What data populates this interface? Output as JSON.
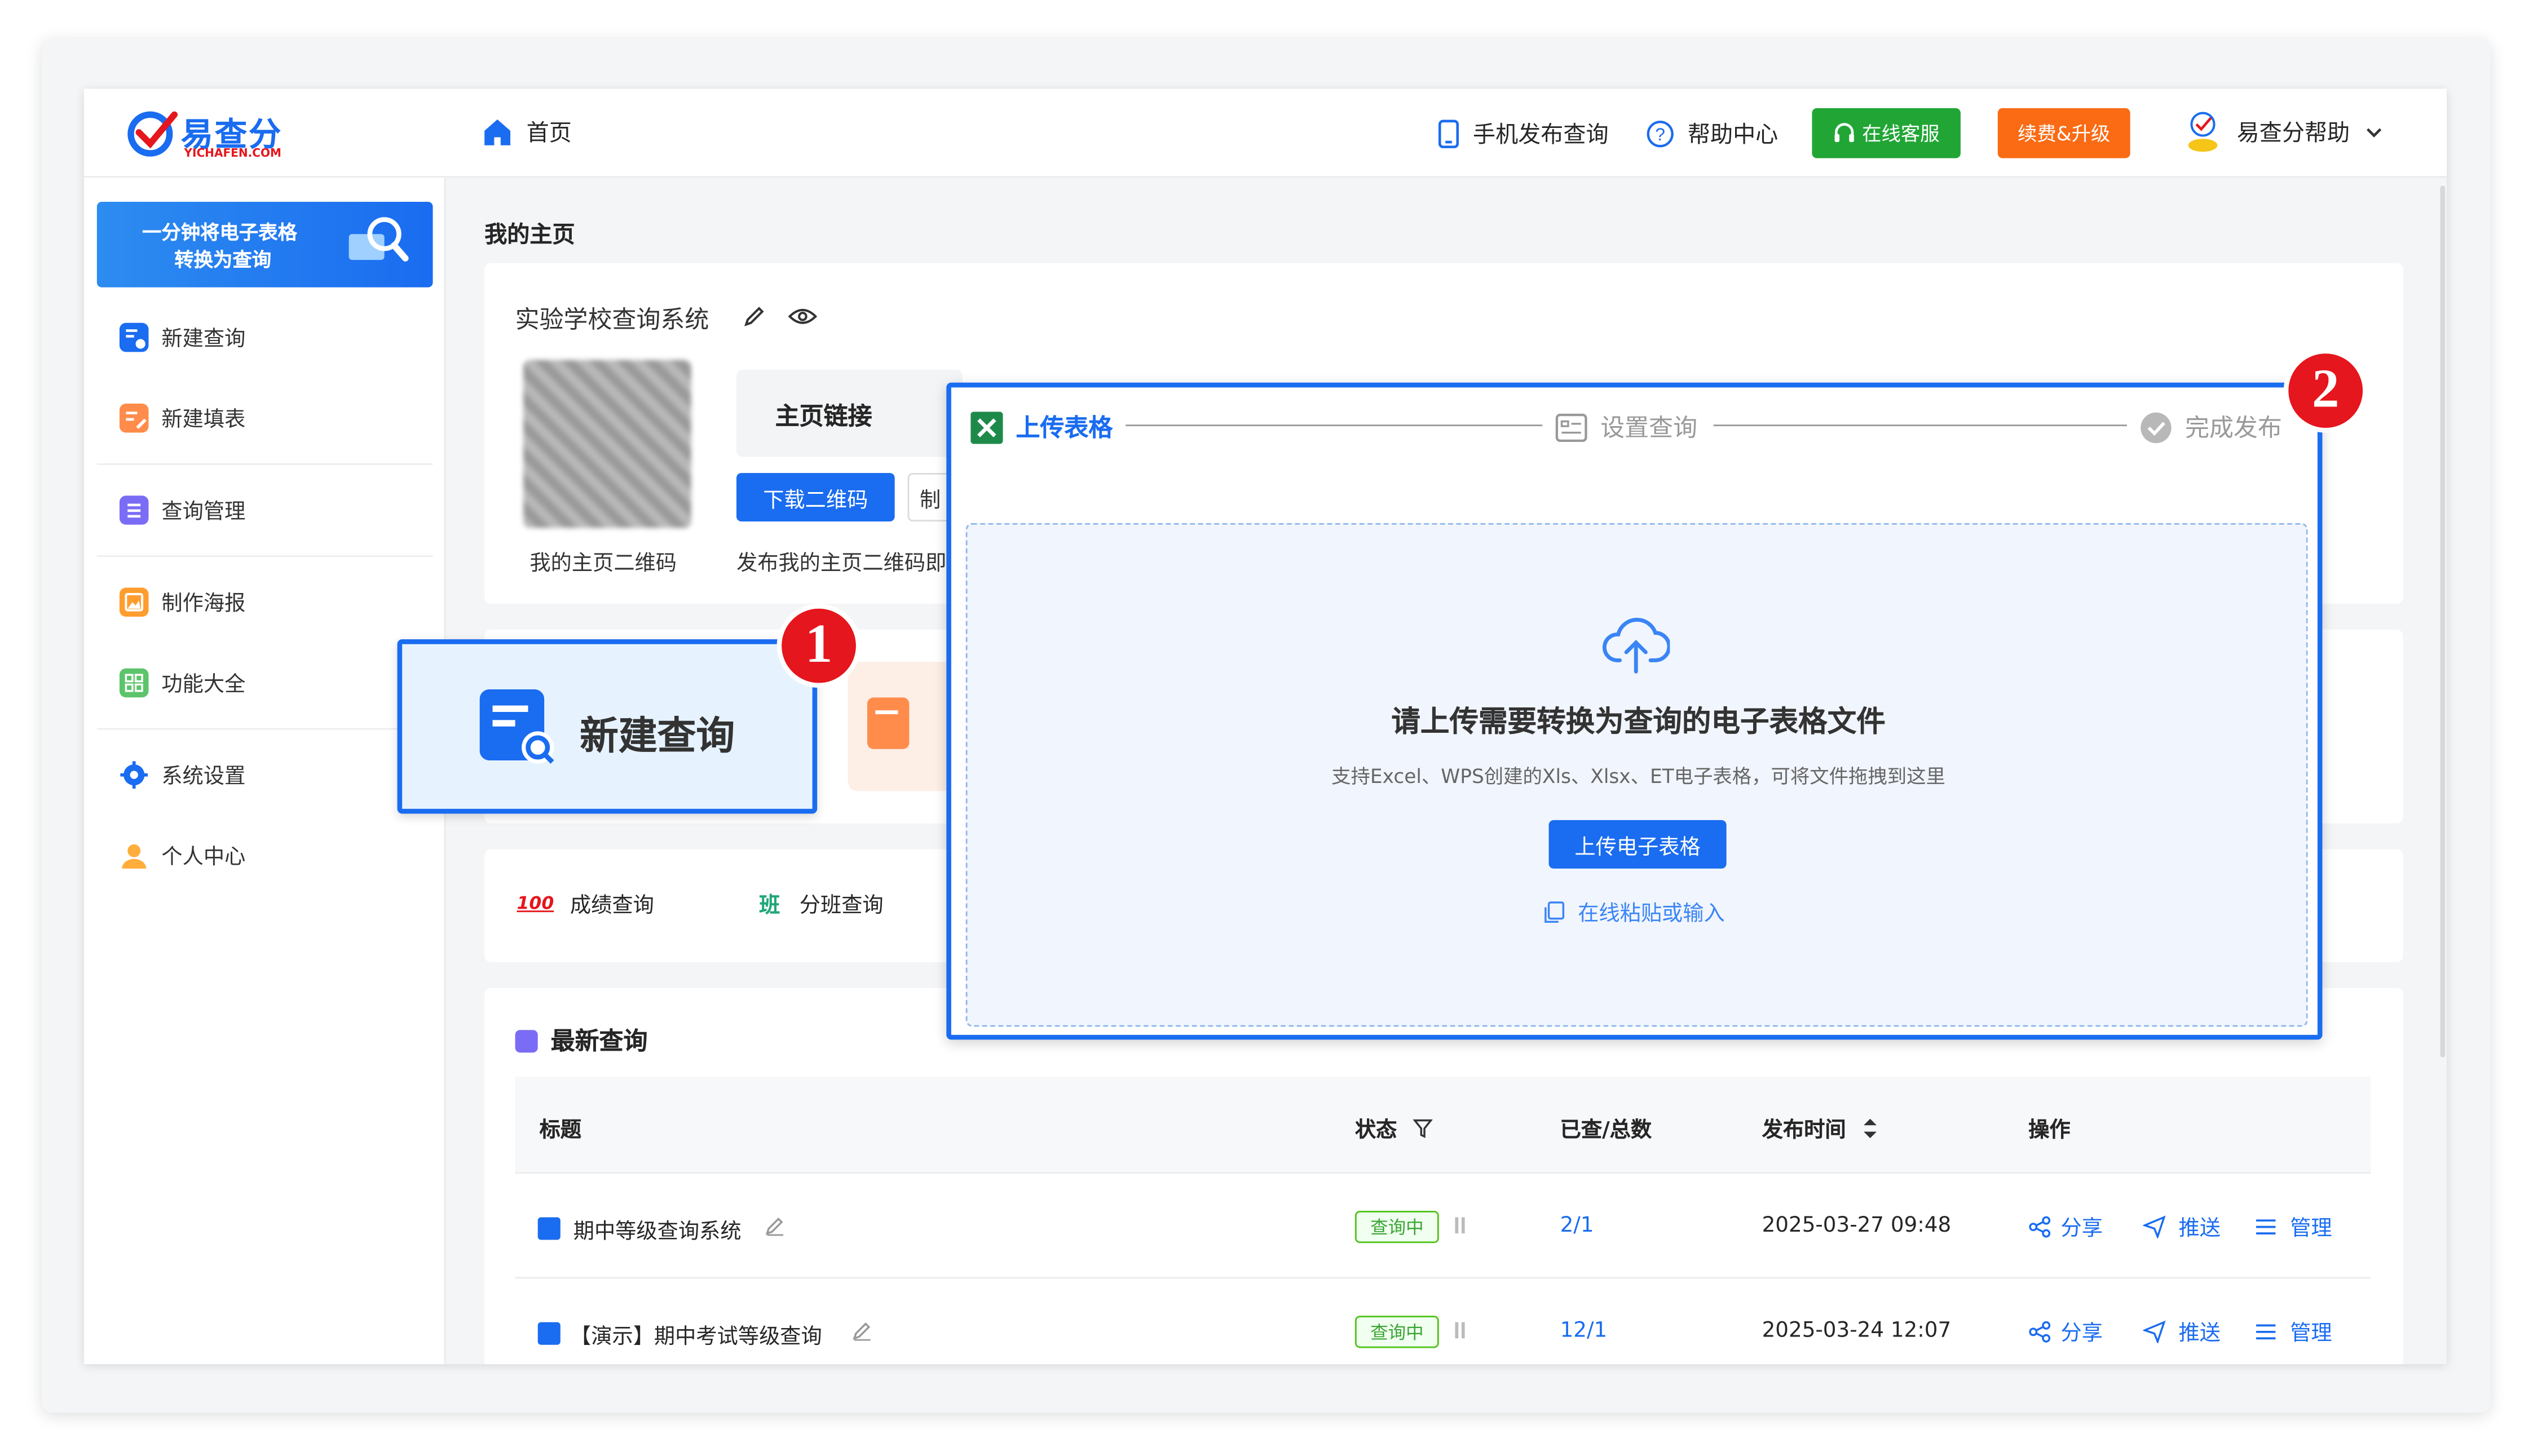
{
  "logo": {
    "name": "易查分",
    "sub": "YICHAFEN.COM"
  },
  "header": {
    "home": "首页",
    "mobile_publish": "手机发布查询",
    "help_center": "帮助中心",
    "online_service": "在线客服",
    "renew_upgrade": "续费&升级",
    "user_name": "易查分帮助",
    "colors": {
      "green": "#21a635",
      "orange": "#fa6b14",
      "blue": "#1a6cf0"
    }
  },
  "sidebar": {
    "banner": [
      "一分钟将电子表格",
      "转换为查询"
    ],
    "items": [
      {
        "label": "新建查询",
        "icon": "new-query-icon"
      },
      {
        "label": "新建填表",
        "icon": "new-form-icon"
      },
      {
        "label": "查询管理",
        "icon": "query-manage-icon"
      },
      {
        "label": "制作海报",
        "icon": "poster-icon"
      },
      {
        "label": "功能大全",
        "icon": "grid-icon"
      },
      {
        "label": "系统设置",
        "icon": "gear-icon"
      },
      {
        "label": "个人中心",
        "icon": "user-icon"
      }
    ]
  },
  "main": {
    "page_title": "我的主页",
    "system_name": "实验学校查询系统",
    "qr_caption": "我的主页二维码",
    "homepage_link_label": "主页链接",
    "download_qr": "下载二维码",
    "partial_button": "制",
    "publish_text": "发布我的主页二维码即",
    "callout_label": "新建查询",
    "shortcuts": [
      {
        "icon_text": "100",
        "label": "成绩查询"
      },
      {
        "icon_text": "班",
        "label": "分班查询"
      }
    ],
    "latest_title": "最新查询",
    "table": {
      "headers": [
        "标题",
        "状态",
        "已查/总数",
        "发布时间",
        "操作"
      ],
      "rows": [
        {
          "title": "期中等级查询系统",
          "status": "查询中",
          "count": "2/1",
          "time": "2025-03-27 09:48"
        },
        {
          "title": "【演示】期中考试等级查询",
          "status": "查询中",
          "count": "12/1",
          "time": "2025-03-24 12:07"
        }
      ],
      "actions": [
        "分享",
        "推送",
        "管理"
      ]
    }
  },
  "upload": {
    "steps": [
      "上传表格",
      "设置查询",
      "完成发布"
    ],
    "title": "请上传需要转换为查询的电子表格文件",
    "hint": "支持Excel、WPS创建的Xls、Xlsx、ET电子表格，可将文件拖拽到这里",
    "button": "上传电子表格",
    "paste": "在线粘贴或输入"
  },
  "markers": [
    "1",
    "2"
  ]
}
